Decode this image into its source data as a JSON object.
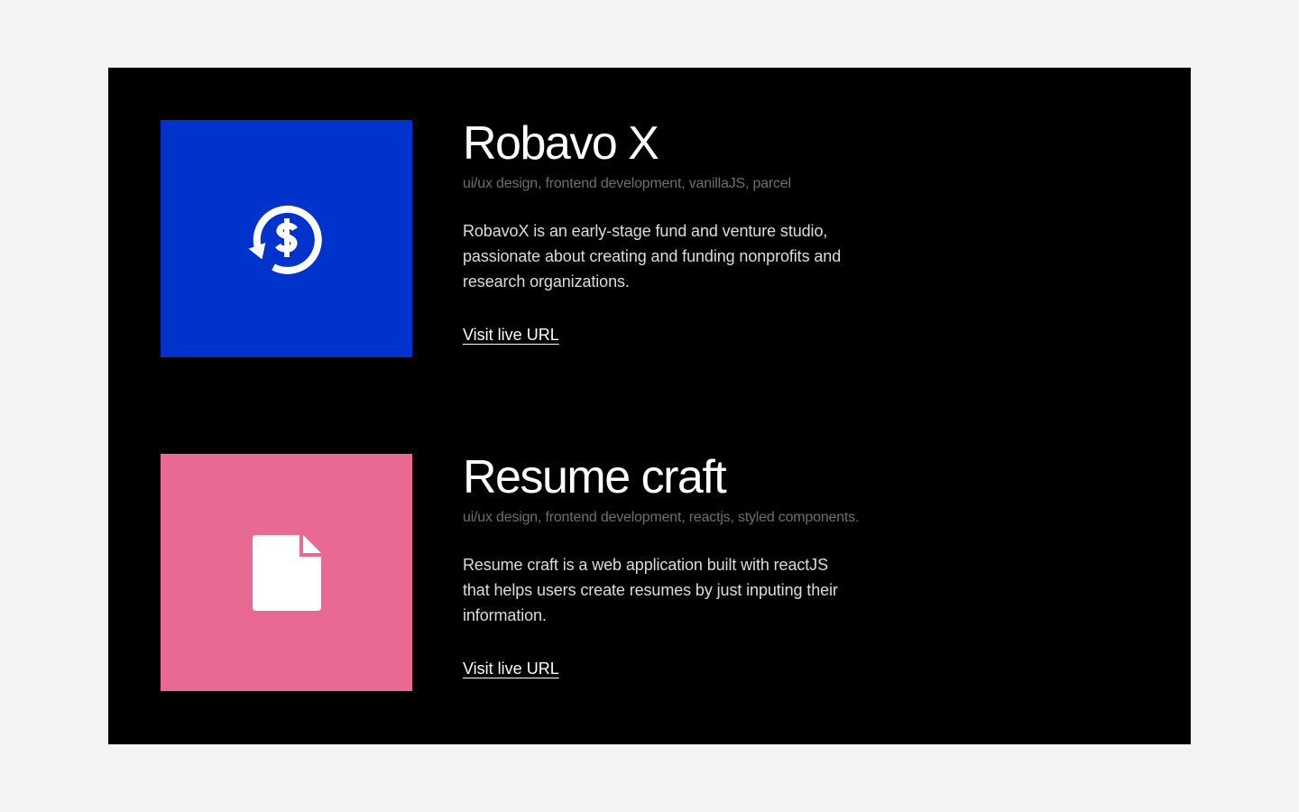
{
  "projects": [
    {
      "title": "Robavo X",
      "tags": "ui/ux design, frontend development, vanillaJS, parcel",
      "description": "RobavoX is an early-stage fund and venture studio, passionate about creating and funding nonprofits and research organizations.",
      "link_label": "Visit live URL",
      "thumb_color": "#0033cc",
      "icon": "dollar-refresh-icon"
    },
    {
      "title": "Resume craft",
      "tags": "ui/ux design, frontend development, reactjs, styled components.",
      "description": "Resume craft is a web application built with reactJS that helps users create resumes by just inputing their information.",
      "link_label": "Visit live URL",
      "thumb_color": "#e86a92",
      "icon": "document-icon"
    }
  ],
  "colors": {
    "page_background": "#f3f3f3",
    "panel_background": "#000000",
    "title": "#ffffff",
    "tags": "#6e6e6e",
    "description": "#dcdcdc"
  }
}
